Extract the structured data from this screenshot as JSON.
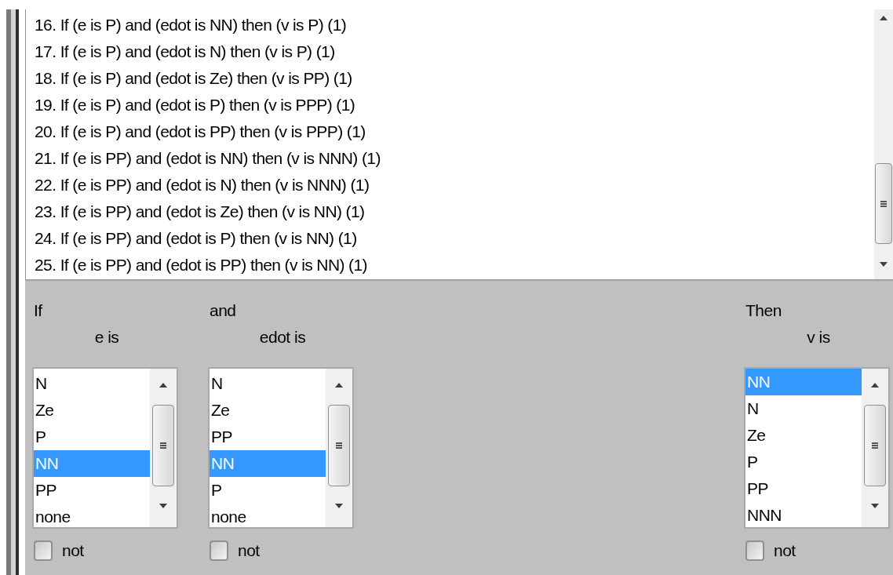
{
  "rules": [
    "16. If (e is P) and (edot is NN) then (v is P) (1)",
    "17. If (e is P) and (edot is N) then (v is P) (1)",
    "18. If (e is P) and (edot is Ze) then (v is PP) (1)",
    "19. If (e is P) and (edot is P) then (v is PPP) (1)",
    "20. If (e is P) and (edot is PP) then (v is PPP) (1)",
    "21. If (e is PP) and (edot is NN) then (v is NNN) (1)",
    "22. If (e is PP) and (edot is N) then (v is NNN) (1)",
    "23. If (e is PP) and (edot is Ze) then (v is NN) (1)",
    "24. If (e is PP) and (edot is P) then (v is NN) (1)",
    "25. If (e is PP) and (edot is PP) then (v is NN) (1)"
  ],
  "columns": [
    {
      "kind": "antecedent",
      "connector": "If",
      "label": "e is",
      "options": [
        {
          "text": "N",
          "selected": false
        },
        {
          "text": "Ze",
          "selected": false
        },
        {
          "text": "P",
          "selected": false
        },
        {
          "text": "NN",
          "selected": true
        },
        {
          "text": "PP",
          "selected": false
        },
        {
          "text": "none",
          "selected": false
        }
      ],
      "not": {
        "label": "not",
        "checked": false
      }
    },
    {
      "kind": "antecedent",
      "connector": "and",
      "label": "edot is",
      "options": [
        {
          "text": "N",
          "selected": false
        },
        {
          "text": "Ze",
          "selected": false
        },
        {
          "text": "PP",
          "selected": false
        },
        {
          "text": "NN",
          "selected": true
        },
        {
          "text": "P",
          "selected": false
        },
        {
          "text": "none",
          "selected": false
        }
      ],
      "not": {
        "label": "not",
        "checked": false
      }
    },
    {
      "kind": "consequent",
      "connector": "Then",
      "label": "v is",
      "options": [
        {
          "text": "NN",
          "selected": true
        },
        {
          "text": "N",
          "selected": false
        },
        {
          "text": "Ze",
          "selected": false
        },
        {
          "text": "P",
          "selected": false
        },
        {
          "text": "PP",
          "selected": false
        },
        {
          "text": "NNN",
          "selected": false
        }
      ],
      "not": {
        "label": "not",
        "checked": false
      }
    }
  ]
}
